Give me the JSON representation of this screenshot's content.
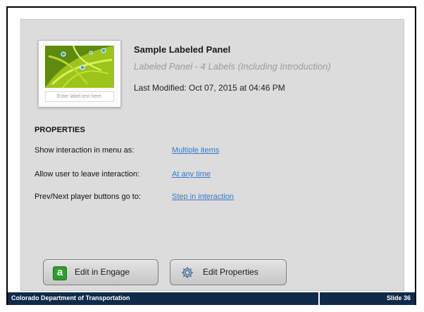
{
  "panel": {
    "thumbnail": {
      "image_icon": "green-leaves-image",
      "label_placeholder": "Enter label text here."
    },
    "title": "Sample Labeled Panel",
    "subtitle": "Labeled Panel - 4 Labels (Including Introduction)",
    "last_modified": "Last Modified: Oct 07, 2015 at 04:46 PM"
  },
  "properties": {
    "heading": "PROPERTIES",
    "items": [
      {
        "label": "Show interaction in menu as:",
        "value": "Multiple items"
      },
      {
        "label": "Allow user to leave interaction:",
        "value": "At any time"
      },
      {
        "label": "Prev/Next player buttons go to:",
        "value": "Step in interaction"
      }
    ]
  },
  "buttons": {
    "engage": {
      "label": "Edit in Engage",
      "icon": "engage-a-icon",
      "icon_glyph": "a",
      "icon_color": "#2e9f2e"
    },
    "properties": {
      "label": "Edit Properties",
      "icon": "gear-icon"
    }
  },
  "footer": {
    "left": "Colorado Department of Transportation",
    "right": "Slide 36",
    "background": "#0f2a4a"
  },
  "colors": {
    "panel_bg": "#dcdcdc",
    "link": "#3a78c9"
  }
}
